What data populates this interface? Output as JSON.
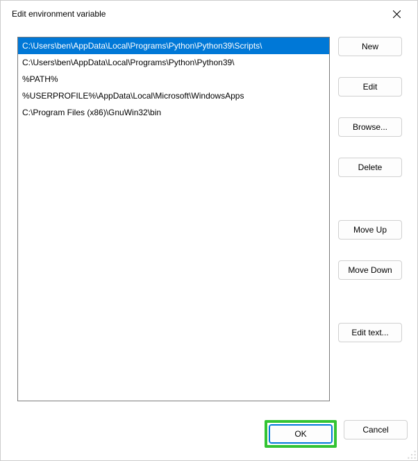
{
  "title": "Edit environment variable",
  "list": {
    "items": [
      "C:\\Users\\ben\\AppData\\Local\\Programs\\Python\\Python39\\Scripts\\",
      "C:\\Users\\ben\\AppData\\Local\\Programs\\Python\\Python39\\",
      "%PATH%",
      "%USERPROFILE%\\AppData\\Local\\Microsoft\\WindowsApps",
      "C:\\Program Files (x86)\\GnuWin32\\bin"
    ],
    "selectedIndex": 0
  },
  "buttons": {
    "new": "New",
    "edit": "Edit",
    "browse": "Browse...",
    "delete": "Delete",
    "moveUp": "Move Up",
    "moveDown": "Move Down",
    "editText": "Edit text...",
    "ok": "OK",
    "cancel": "Cancel"
  }
}
